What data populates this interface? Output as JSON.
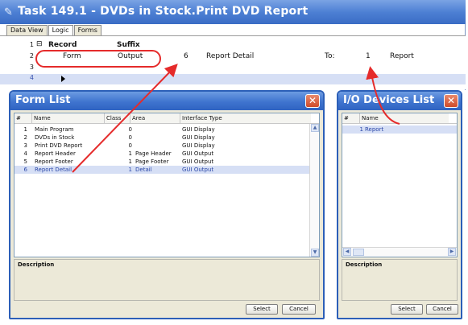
{
  "task": {
    "title": "Task 149.1 -   DVDs in Stock.Print DVD Report",
    "tabs": [
      "Data View",
      "Logic",
      "Forms"
    ],
    "active_tab": "Logic",
    "rows": [
      {
        "num": "1",
        "expander": "⊟",
        "record": "Record",
        "suffix": "Suffix"
      },
      {
        "num": "2",
        "form": "Form",
        "output": "Output",
        "value": "6",
        "target": "Report Detail",
        "to_label": "To:",
        "to_value": "1",
        "to_target": "Report"
      },
      {
        "num": "3"
      },
      {
        "num": "4"
      }
    ]
  },
  "form_list": {
    "title": "Form List",
    "columns": [
      "#",
      "Name",
      "Class",
      "Area",
      "Interface Type"
    ],
    "rows": [
      {
        "num": "1",
        "name": "Main Program",
        "class": "0",
        "area": "",
        "interface": "GUI Display"
      },
      {
        "num": "2",
        "name": "DVDs in Stock",
        "class": "0",
        "area": "",
        "interface": "GUI Display"
      },
      {
        "num": "3",
        "name": "Print DVD Report",
        "class": "0",
        "area": "",
        "interface": "GUI Display"
      },
      {
        "num": "4",
        "name": "Report Header",
        "class": "1",
        "area": "Page Header",
        "interface": "GUI Output"
      },
      {
        "num": "5",
        "name": "Report Footer",
        "class": "1",
        "area": "Page Footer",
        "interface": "GUI Output"
      },
      {
        "num": "6",
        "name": "Report Detail",
        "class": "1",
        "area": "Detail",
        "interface": "GUI Output"
      }
    ],
    "selected_index": 5,
    "description_label": "Description",
    "select_label": "Select",
    "cancel_label": "Cancel"
  },
  "io_list": {
    "title": "I/O Devices List",
    "columns": [
      "#",
      "Name"
    ],
    "rows": [
      {
        "num": "1",
        "name": "Report"
      }
    ],
    "selected_index": 0,
    "description_label": "Description",
    "select_label": "Select",
    "cancel_label": "Cancel"
  },
  "colors": {
    "titlebar": "#3f74cf",
    "selection": "#d6dff5",
    "annotation": "#e52b2b"
  }
}
